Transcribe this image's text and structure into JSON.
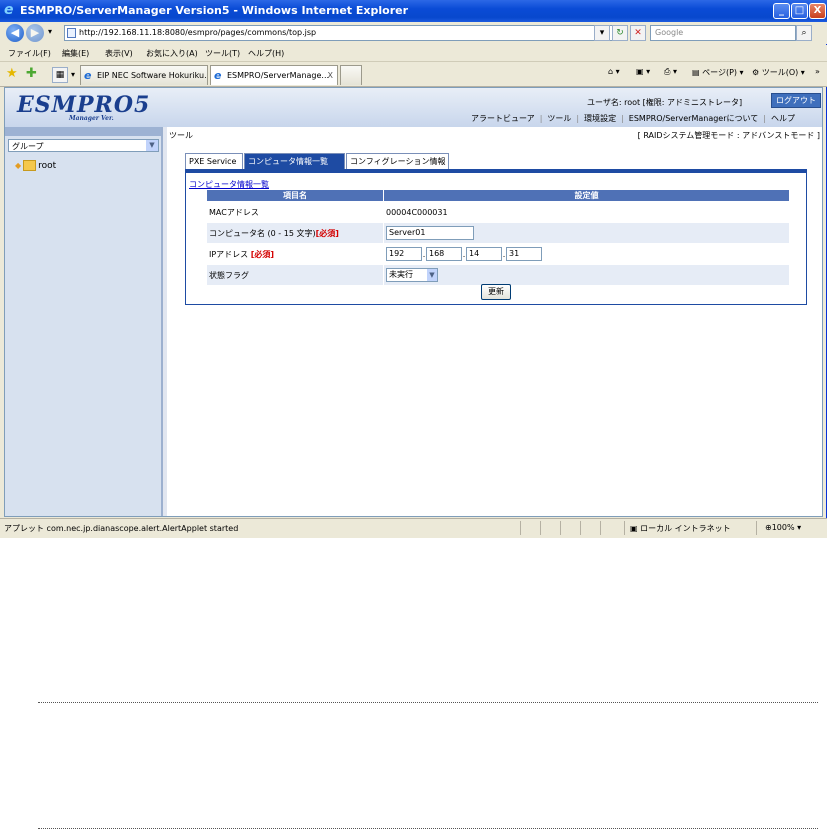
{
  "window": {
    "title": "ESMPRO/ServerManager Version5 - Windows Internet Explorer",
    "minimize": "_",
    "maximize": "□",
    "close": "X"
  },
  "address": {
    "url": "http://192.168.11.18:8080/esmpro/pages/commons/top.jsp",
    "search_placeholder": "Google"
  },
  "menu": {
    "file": "ファイル(F)",
    "edit": "編集(E)",
    "view": "表示(V)",
    "favorites": "お気に入り(A)",
    "tools": "ツール(T)",
    "help": "ヘルプ(H)"
  },
  "tabs": [
    {
      "label": "EIP NEC Software Hokuriku..."
    },
    {
      "label": "ESMPRO/ServerManage...",
      "close": "X"
    }
  ],
  "commandbar": {
    "page": "ページ(P)",
    "tools": "ツール(O)"
  },
  "app": {
    "logo": "ESMPRO5",
    "logo_sub": "Manager Ver.",
    "user_info": "ユーザ名: root [権限: アドミニストレータ]",
    "logout": "ログアウト",
    "links": [
      "アラートビューア",
      "ツール",
      "環境設定",
      "ESMPRO/ServerManagerについて",
      "ヘルプ"
    ]
  },
  "sidebar": {
    "group_select": "グループ",
    "tree_root": "root"
  },
  "main": {
    "breadcrumb": "ツール",
    "mode": "[ RAIDシステム管理モード : アドバンストモード ]",
    "tabs": [
      "PXE Service",
      "コンピュータ情報一覧",
      "コンフィグレーション情報"
    ],
    "section_link": "コンピュータ情報一覧",
    "headers": [
      "項目名",
      "設定値"
    ],
    "rows": {
      "mac_label": "MACアドレス",
      "mac_value": "00004C000031",
      "name_label": "コンピュータ名 (0 - 15 文字)",
      "name_required": "[必須]",
      "name_value": "Server01",
      "ip_label": "IPアドレス",
      "ip_required": "[必須]",
      "ip_parts": [
        "192",
        "168",
        "14",
        "31"
      ],
      "status_label": "状態フラグ",
      "status_value": "未実行"
    },
    "update_button": "更新"
  },
  "statusbar": {
    "text": "アプレット com.nec.jp.dianascope.alert.AlertApplet started",
    "zone": "ローカル イントラネット",
    "zoom": "100%"
  }
}
